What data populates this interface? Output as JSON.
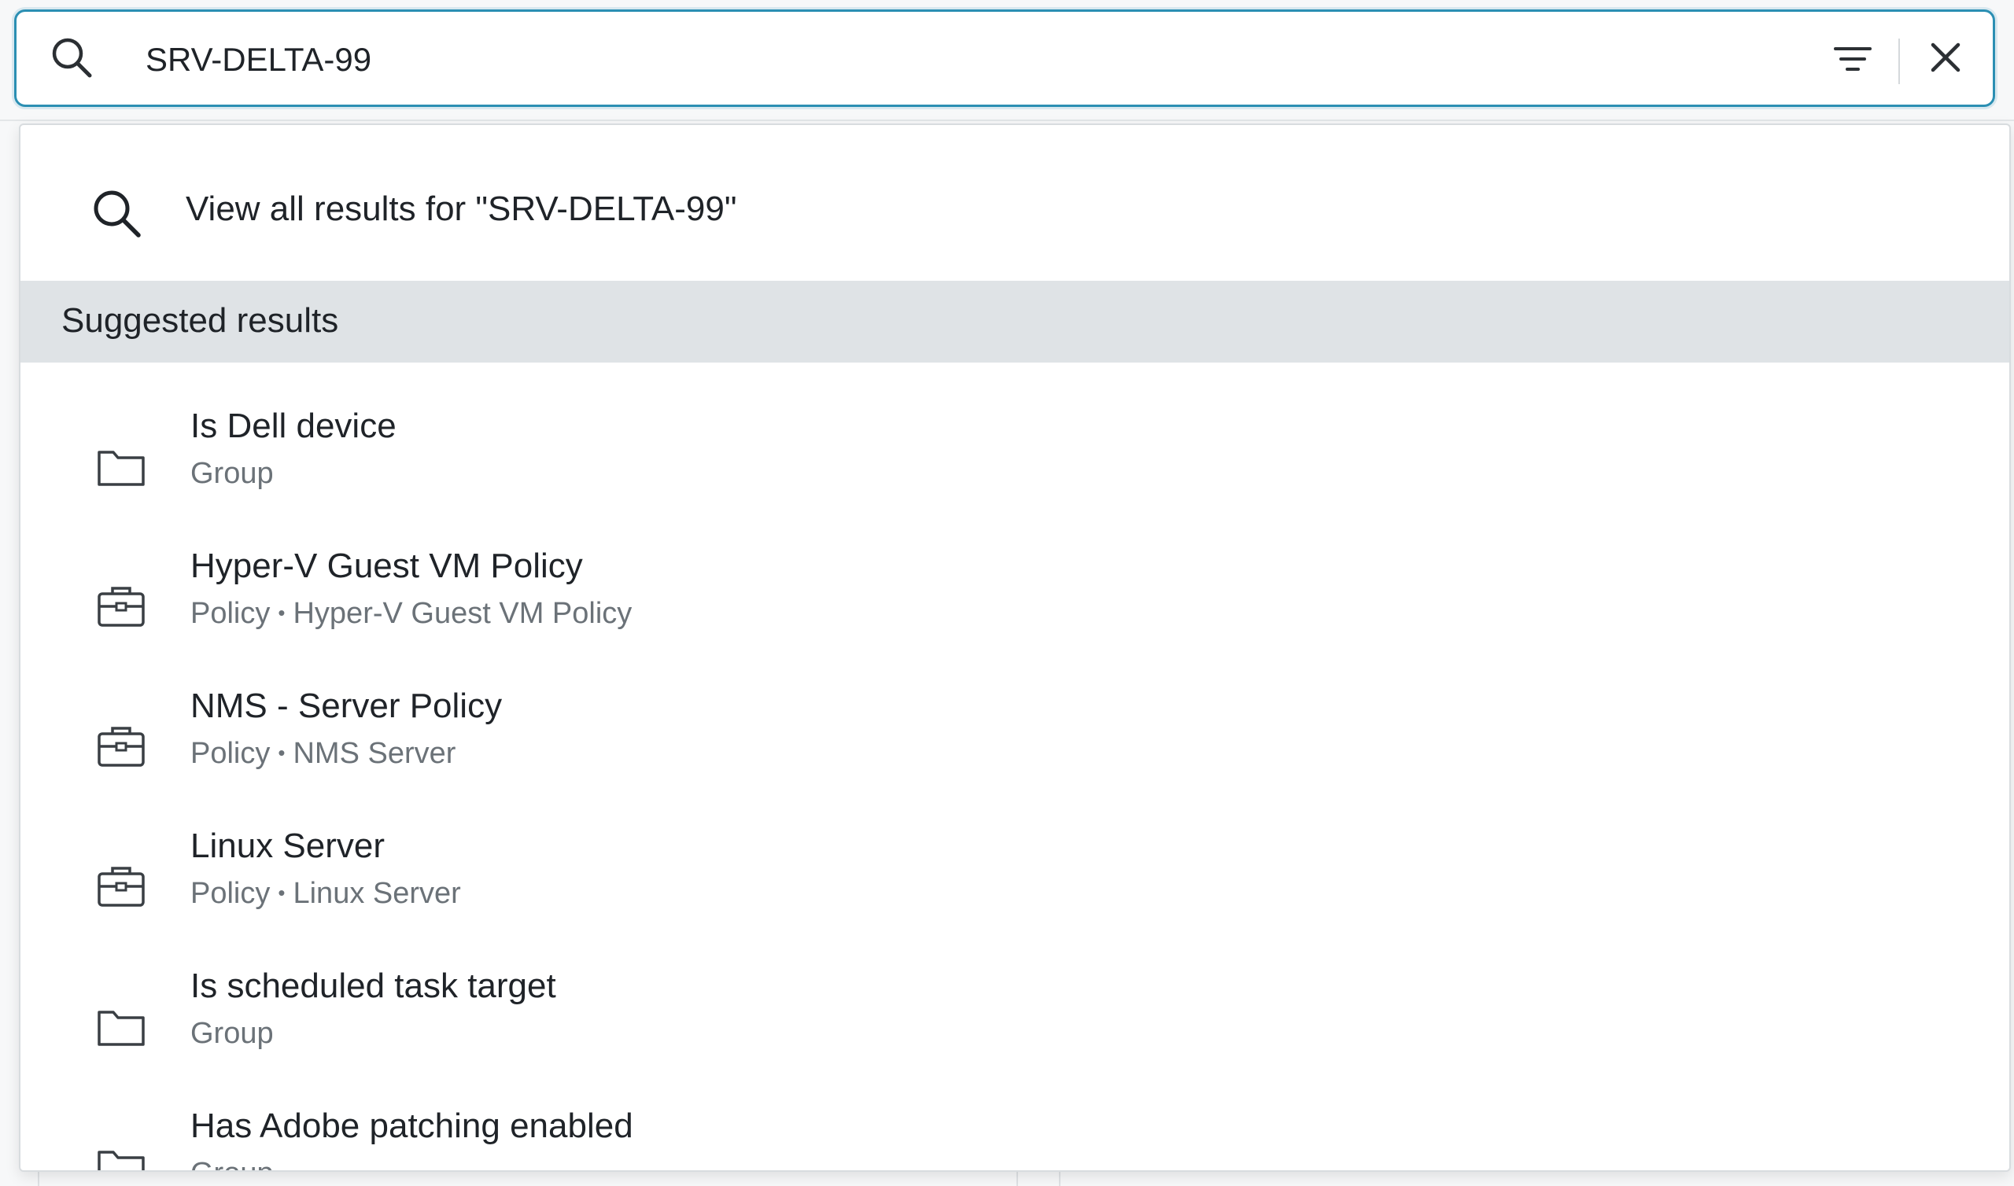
{
  "search": {
    "value": "SRV-DELTA-99",
    "filter_icon": "filter-icon",
    "clear_icon": "close-icon",
    "leading_icon": "search-icon"
  },
  "dropdown": {
    "view_all_label": "View all results for \"SRV-DELTA-99\"",
    "section_title": "Suggested results",
    "results": [
      {
        "title": "Is Dell device",
        "type": "Group",
        "detail": "",
        "icon": "folder-icon"
      },
      {
        "title": "Hyper-V Guest VM Policy",
        "type": "Policy",
        "detail": "Hyper-V Guest VM Policy",
        "icon": "briefcase-icon"
      },
      {
        "title": "NMS - Server Policy",
        "type": "Policy",
        "detail": "NMS Server",
        "icon": "briefcase-icon"
      },
      {
        "title": "Linux Server",
        "type": "Policy",
        "detail": "Linux Server",
        "icon": "briefcase-icon"
      },
      {
        "title": "Is scheduled task target",
        "type": "Group",
        "detail": "",
        "icon": "folder-icon"
      },
      {
        "title": "Has Adobe patching enabled",
        "type": "Group",
        "detail": "",
        "icon": "folder-icon"
      }
    ]
  },
  "colors": {
    "accent": "#2b8fb3",
    "section_bg": "#dfe3e6",
    "subtext": "#6b7278"
  }
}
